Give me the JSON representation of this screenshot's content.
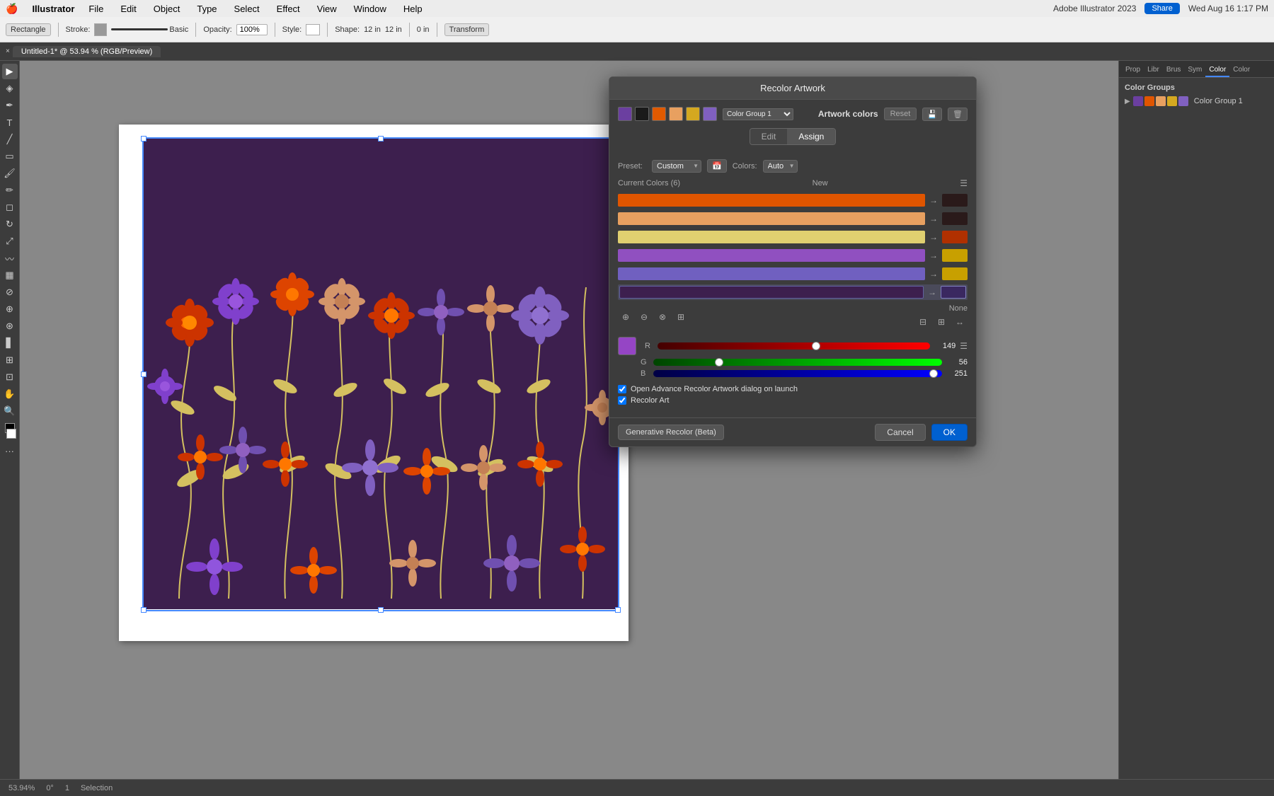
{
  "menubar": {
    "apple": "🍎",
    "app": "Illustrator",
    "items": [
      "File",
      "Edit",
      "Object",
      "Type",
      "Select",
      "Effect",
      "View",
      "Window",
      "Help"
    ],
    "right": {
      "share_btn": "Share",
      "time": "Wed Aug 16  1:17 PM"
    }
  },
  "toolbar": {
    "shape": "Rectangle",
    "stroke_label": "Stroke:",
    "stroke_value": "",
    "fill_label": "Basic",
    "opacity_label": "Opacity:",
    "opacity_value": "100%",
    "style_label": "Style:",
    "shape_label": "Shape:",
    "width_value": "12 in",
    "height_value": "12 in",
    "transform_btn": "Transform",
    "angle_value": "0 in"
  },
  "tabbar": {
    "close": "×",
    "title": "Untitled-1* @ 53.94 % (RGB/Preview)"
  },
  "recolor_dialog": {
    "title": "Recolor Artwork",
    "artwork_colors_label": "Artwork colors",
    "reset_btn": "Reset",
    "edit_tab": "Edit",
    "assign_tab": "Assign",
    "preset_label": "Preset:",
    "preset_value": "Custom",
    "colors_label": "Colors:",
    "colors_value": "Auto",
    "current_colors_label": "Current Colors (6)",
    "new_label": "New",
    "color_rows": [
      {
        "id": "orange",
        "current_color": "#e05500",
        "new_color": "#2a1a1a",
        "arrow": "→"
      },
      {
        "id": "peach",
        "current_color": "#e8a060",
        "new_color": "#2a1a1a",
        "arrow": "→"
      },
      {
        "id": "yellow",
        "current_color": "#e0d070",
        "new_color": "#b03000",
        "arrow": "→"
      },
      {
        "id": "purple",
        "current_color": "#9050c0",
        "new_color": "#c8a000",
        "arrow": "→"
      },
      {
        "id": "lavender",
        "current_color": "#7060c0",
        "new_color": "#c8a000",
        "arrow": "→"
      },
      {
        "id": "darkpurple",
        "current_color": "#3d1f4e",
        "new_color": "#3a2860",
        "arrow": "→"
      }
    ],
    "rgb": {
      "preview_color": "#9545c5",
      "r_label": "R",
      "r_value": "149",
      "r_percent": 58,
      "g_label": "G",
      "g_value": "56",
      "g_percent": 22,
      "b_label": "B",
      "b_value": "251",
      "b_percent": 98
    },
    "none_label": "None",
    "checkboxes": [
      {
        "id": "cb1",
        "label": "Open Advance Recolor Artwork dialog on launch",
        "checked": true
      },
      {
        "id": "cb2",
        "label": "Recolor Art",
        "checked": true
      }
    ],
    "gen_recolor_btn": "Generative Recolor (Beta)",
    "cancel_btn": "Cancel",
    "ok_btn": "OK"
  },
  "color_groups": {
    "title": "Color Groups",
    "group1": {
      "label": "Color Group 1",
      "swatches": [
        "#6b3fa0",
        "#e05500",
        "#e8a060",
        "#d4a820",
        "#8060c0"
      ]
    }
  },
  "right_panel_tabs": [
    "Prop",
    "Libr",
    "Brus",
    "Sym",
    "Color",
    "Color"
  ],
  "statusbar": {
    "zoom": "53.94%",
    "angle": "0°",
    "page": "1",
    "mode": "Selection"
  }
}
